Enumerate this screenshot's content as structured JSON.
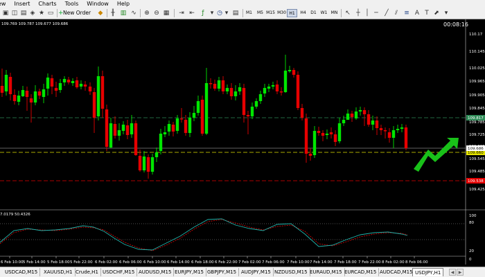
{
  "menu": [
    "ew",
    "Insert",
    "Charts",
    "Tools",
    "Window",
    "Help"
  ],
  "toolbar": {
    "new_order_label": "New Order",
    "timeframes": [
      "M1",
      "M5",
      "M15",
      "M30",
      "H1",
      "H4",
      "D1",
      "W1",
      "MN"
    ],
    "active_timeframe": "H1"
  },
  "chart": {
    "ohlc_info": "109.769 109.787 109.677 109.686",
    "timer": "00:08:16",
    "price_labels": [
      "110.17",
      "110.145",
      "110.025",
      "109.965",
      "109.905",
      "109.845",
      "109.785",
      "109.725",
      "109.605",
      "109.545",
      "109.485",
      "109.425"
    ],
    "bid_label": "109.686",
    "yellow_line_label": "109.660",
    "green_line_label": "109.817",
    "red_line_label": "109.538",
    "time_labels": [
      "6 Feb 10:00",
      "5 Feb 14:00",
      "5 Feb 18:00",
      "5 Feb 22:00",
      "6 Feb 02:00",
      "6 Feb 06:00",
      "6 Feb 10:00",
      "6 Feb 14:00",
      "6 Feb 18:00",
      "6 Feb 22:00",
      "7 Feb 02:00",
      "7 Feb 06:00",
      "7 Feb 10:00",
      "7 Feb 14:00",
      "7 Feb 18:00",
      "7 Feb 22:00",
      "8 Feb 02:00",
      "8 Feb 06:00"
    ],
    "colors": {
      "bull": "#00e600",
      "bear": "#e60000",
      "green_line": "#2e8b57",
      "yellow_line": "#e6e600",
      "red_line": "#e60000",
      "arrow": "#19c119",
      "stoch_main": "#20b2aa",
      "stoch_signal": "#e60000"
    }
  },
  "indicator": {
    "info": "7.0179 50.4326",
    "levels": [
      "100",
      "80",
      "20",
      "0"
    ]
  },
  "tabs": [
    "USDCAD,M15",
    "XAUUSD,H1",
    "Crude,H1",
    "USDCHF,M15",
    "AUDUSD,M15",
    "EURJPY,M15",
    "GBPJPY,M15",
    "AUDJPY,M15",
    "NZDUSD,M15",
    "EURAUD,M15",
    "EURCAD,M15",
    "AUDCAD,M15",
    "USDJPY,H1"
  ],
  "active_tab": "USDJPY,H1"
}
